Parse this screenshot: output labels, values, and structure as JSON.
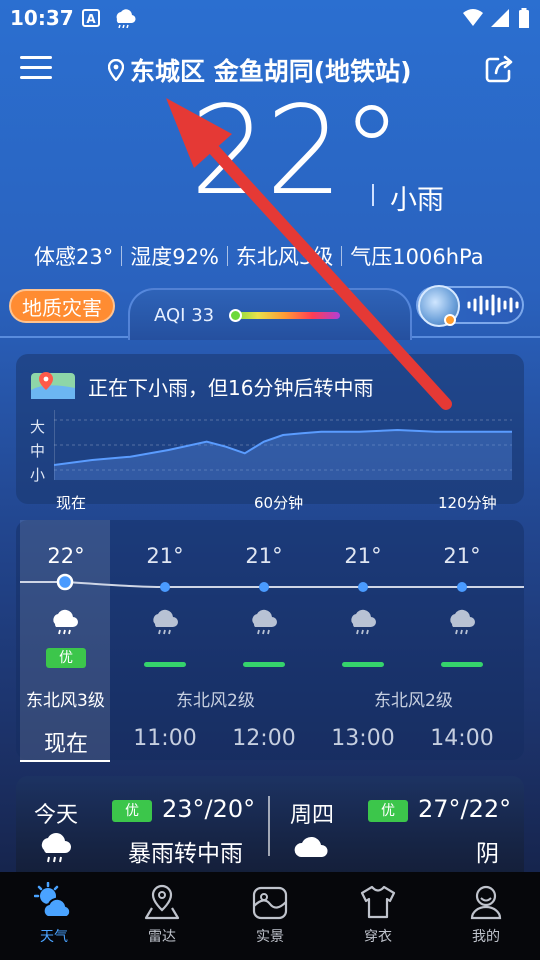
{
  "status_bar": {
    "time": "10:37"
  },
  "header": {
    "location": "东城区 金鱼胡同(地铁站)"
  },
  "current": {
    "temperature": "22°",
    "condition": "小雨",
    "stats": [
      "体感23°",
      "湿度92%",
      "东北风3级",
      "气压1006hPa"
    ]
  },
  "alert_badge": "地质灾害",
  "aqi": {
    "label": "AQI 33",
    "value": 33
  },
  "precipitation": {
    "summary": "正在下小雨，但16分钟后转中雨",
    "levels": [
      "大",
      "中",
      "小"
    ],
    "x_labels": [
      "现在",
      "60分钟",
      "120分钟"
    ],
    "chart_data": {
      "type": "area",
      "x": [
        0,
        10,
        20,
        30,
        40,
        45,
        50,
        55,
        60,
        65,
        70,
        80,
        90,
        100,
        110,
        120
      ],
      "values": [
        0.3,
        0.6,
        0.8,
        1.2,
        1.7,
        1.4,
        1.0,
        1.7,
        2.1,
        2.2,
        2.3,
        2.3,
        2.4,
        2.3,
        2.3,
        2.3
      ],
      "ylim": [
        0,
        3
      ]
    }
  },
  "hourly": {
    "items": [
      {
        "temp": "22°",
        "time": "现在",
        "quality": "优"
      },
      {
        "temp": "21°",
        "time": "11:00"
      },
      {
        "temp": "21°",
        "time": "12:00"
      },
      {
        "temp": "21°",
        "time": "13:00"
      },
      {
        "temp": "21°",
        "time": "14:00"
      }
    ],
    "wind": [
      "东北风3级",
      "东北风2级",
      "东北风2级"
    ]
  },
  "daily": {
    "today": {
      "day": "今天",
      "quality": "优",
      "range": "23°/20°",
      "condition": "暴雨转中雨"
    },
    "thursday": {
      "day": "周四",
      "quality": "优",
      "range": "27°/22°",
      "condition": "阴"
    }
  },
  "nav": {
    "items": [
      {
        "label": "天气",
        "icon": "weather-icon"
      },
      {
        "label": "雷达",
        "icon": "radar-icon"
      },
      {
        "label": "实景",
        "icon": "photo-icon"
      },
      {
        "label": "穿衣",
        "icon": "clothing-icon"
      },
      {
        "label": "我的",
        "icon": "profile-icon"
      }
    ]
  },
  "colors": {
    "accent": "#4aa3ff",
    "alert": "#ff8c32",
    "quality_good": "#3cc64b",
    "arrow": "#e53935"
  }
}
